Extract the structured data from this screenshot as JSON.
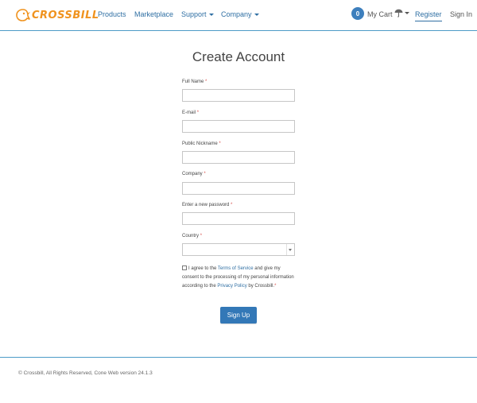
{
  "header": {
    "logo_text": "CROSSBILL",
    "nav": [
      {
        "label": "Products"
      },
      {
        "label": "Marketplace"
      },
      {
        "label": "Support"
      },
      {
        "label": "Company"
      }
    ],
    "cart_count": "0",
    "cart_label": "My Cart",
    "register_label": "Register",
    "signin_label": "Sign In"
  },
  "form": {
    "title": "Create Account",
    "required_marker": "*",
    "fields": [
      {
        "label": "Full Name",
        "value": ""
      },
      {
        "label": "E-mail",
        "value": ""
      },
      {
        "label": "Public Nickname",
        "value": ""
      },
      {
        "label": "Company",
        "value": ""
      },
      {
        "label": "Enter a new password",
        "value": ""
      },
      {
        "label": "Country",
        "value": ""
      }
    ],
    "agree": {
      "pre": "I agree to the ",
      "terms_link": "Terms of Service",
      "mid": " and give my consent to the processing of my personal information according to the ",
      "privacy_link": "Privacy Policy",
      "post": " by Crossbill."
    },
    "submit_label": "Sign Up"
  },
  "footer": {
    "text": "© Crossbill, All Rights Reserved, Cone Web version 24.1.3"
  },
  "colors": {
    "accent": "#3378b7",
    "link": "#2f6fa3",
    "logo": "#f0931f",
    "required": "#d9534f"
  },
  "icons": [
    "crossbill-logo-icon",
    "umbrella-icon",
    "chevron-down-icon"
  ]
}
